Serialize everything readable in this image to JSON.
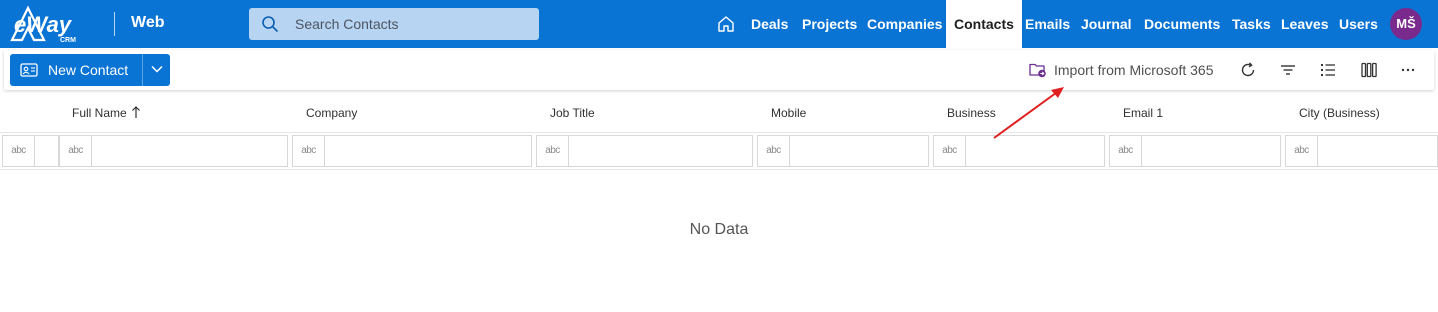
{
  "brand": {
    "logo_text": "eWay",
    "logo_sub": "CRM",
    "app_name": "Web"
  },
  "search": {
    "placeholder": "Search Contacts",
    "icon": "search-icon"
  },
  "nav": {
    "home_icon": "home-icon",
    "items": [
      {
        "label": "Deals",
        "active": false
      },
      {
        "label": "Projects",
        "active": false
      },
      {
        "label": "Companies",
        "active": false
      },
      {
        "label": "Contacts",
        "active": true
      },
      {
        "label": "Emails",
        "active": false
      },
      {
        "label": "Journal",
        "active": false
      },
      {
        "label": "Documents",
        "active": false
      },
      {
        "label": "Tasks",
        "active": false
      },
      {
        "label": "Leaves",
        "active": false
      },
      {
        "label": "Users",
        "active": false
      }
    ],
    "avatar_initials": "MŠ"
  },
  "toolbar": {
    "new_label": "New Contact",
    "import_label": "Import from Microsoft 365",
    "icons": [
      "refresh-icon",
      "filter-icon",
      "list-view-icon",
      "columns-icon",
      "more-icon"
    ]
  },
  "grid": {
    "columns": [
      "Full Name",
      "Company",
      "Job Title",
      "Mobile",
      "Business",
      "Email 1",
      "City (Business)"
    ],
    "sorted_column": "Full Name",
    "sort_direction": "ascending",
    "filter_type_label": "abc",
    "empty_text": "No Data"
  },
  "colors": {
    "brand_blue": "#0a74d4",
    "avatar": "#7a2a8c",
    "annotation_arrow": "#e02020"
  }
}
